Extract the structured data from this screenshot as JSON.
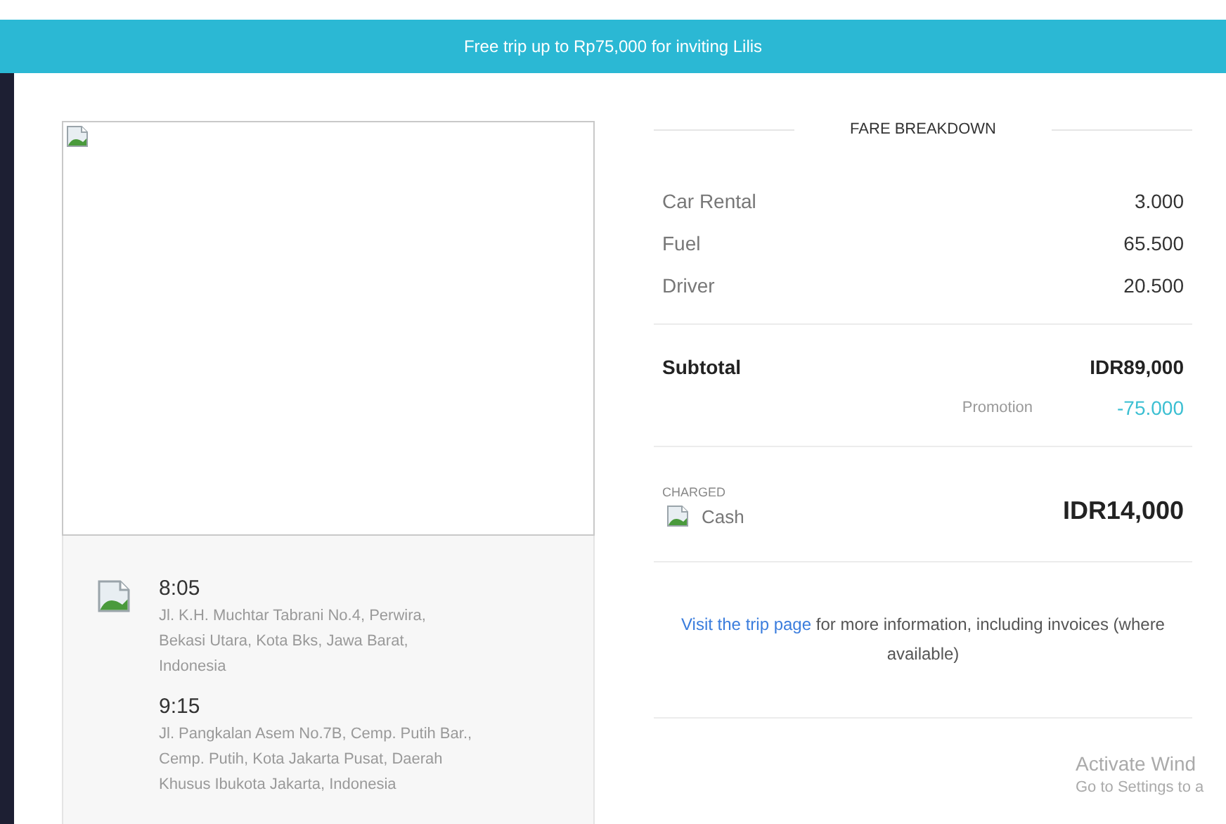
{
  "banner": {
    "text": "Free trip up to Rp75,000 for inviting Lilis"
  },
  "trip": {
    "stops": [
      {
        "time": "8:05",
        "address": "Jl. K.H. Muchtar Tabrani No.4, Perwira, Bekasi Utara, Kota Bks, Jawa Barat, Indonesia",
        "has_icon": true
      },
      {
        "time": "9:15",
        "address": "Jl. Pangkalan Asem No.7B, Cemp. Putih Bar., Cemp. Putih, Kota Jakarta Pusat, Daerah Khusus Ibukota Jakarta, Indonesia",
        "has_icon": false
      }
    ]
  },
  "fare": {
    "heading": "FARE BREAKDOWN",
    "items": [
      {
        "label": "Car Rental",
        "value": "3.000"
      },
      {
        "label": "Fuel",
        "value": "65.500"
      },
      {
        "label": "Driver",
        "value": "20.500"
      }
    ],
    "subtotal": {
      "label": "Subtotal",
      "value": "IDR89,000"
    },
    "promotion": {
      "label": "Promotion",
      "value": "-75.000"
    },
    "charged": {
      "label": "CHARGED",
      "method": "Cash",
      "amount": "IDR14,000"
    },
    "note": {
      "link": "Visit the trip page",
      "text": "for more information, including invoices (where available)"
    }
  },
  "activation": {
    "title": "Activate Wind",
    "subtitle": "Go to Settings to a"
  }
}
